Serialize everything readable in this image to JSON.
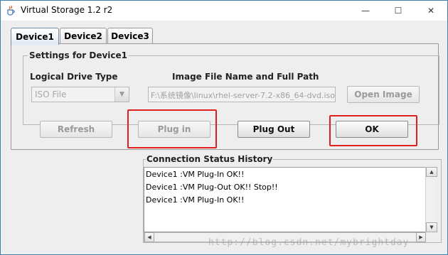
{
  "window": {
    "title": "Virtual Storage 1.2 r2",
    "controls": {
      "minimize": "—",
      "maximize": "☐",
      "close": "✕"
    }
  },
  "tabs": [
    {
      "label": "Device1",
      "active": true
    },
    {
      "label": "Device2",
      "active": false
    },
    {
      "label": "Device3",
      "active": false
    }
  ],
  "settings": {
    "group_title": "Settings for Device1",
    "drive_type_label": "Logical Drive Type",
    "drive_type_value": "ISO File",
    "image_path_label": "Image File Name and Full Path",
    "image_path_value": "F:\\系统镜像\\linux\\rhel-server-7.2-x86_64-dvd.iso",
    "open_image_label": "Open Image"
  },
  "actions": {
    "refresh_label": "Refresh",
    "plug_in_label": "Plug in",
    "plug_out_label": "Plug Out",
    "ok_label": "OK"
  },
  "status": {
    "group_title": "Connection Status History",
    "log": [
      "Device1 :VM Plug-In OK!!",
      "Device1 :VM Plug-Out OK!! Stop!!",
      "Device1 :VM Plug-In OK!!"
    ]
  },
  "watermark": "http://blog.csdn.net/mybrightday",
  "colors": {
    "highlight": "#e02020",
    "disabled_text": "#9a9a9a",
    "panel_bg": "#eeeeee"
  }
}
